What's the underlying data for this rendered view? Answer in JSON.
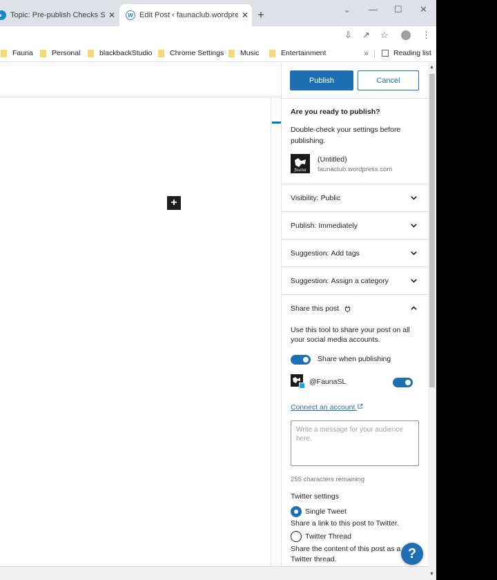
{
  "browser": {
    "tabs": [
      {
        "title": "Topic: Pre-publish Checks Sideba",
        "close": "✕"
      },
      {
        "title": "Edit Post ‹ faunaclub.wordpress.c",
        "close": "✕"
      }
    ],
    "new_tab": "+",
    "bookmarks": [
      "Fauna",
      "Personal",
      "blackbackStudio",
      "Chrome Settings",
      "Music",
      "Entertainment"
    ],
    "bookmarks_more": "»",
    "reading_list": "Reading list"
  },
  "prepublish": {
    "publish_label": "Publish",
    "cancel_label": "Cancel",
    "ready_title": "Are you ready to publish?",
    "ready_desc": "Double-check your settings before publishing.",
    "post_title": "(Untitled)",
    "site_url": "faunaclub.wordpress.com",
    "rows": [
      {
        "key": "Visibility:",
        "value": "Public"
      },
      {
        "key": "Publish:",
        "value": "Immediately"
      },
      {
        "key": "Suggestion:",
        "value": "Add tags"
      },
      {
        "key": "Suggestion:",
        "value": "Assign a category"
      }
    ],
    "share": {
      "title": "Share this post",
      "description": "Use this tool to share your post on all your social media accounts.",
      "toggle_label": "Share when publishing",
      "share_when_publishing": true,
      "account": "@FaunaSL",
      "account_enabled": true,
      "connect_link": "Connect an account",
      "message_placeholder": "Write a message for your audience here.",
      "remaining": "255 characters remaining",
      "twitter_settings": "Twitter settings",
      "options": [
        {
          "label": "Single Tweet",
          "desc": "Share a link to this post to Twitter.",
          "selected": true
        },
        {
          "label": "Twitter Thread",
          "desc": "Share the content of this post as a Twitter thread.",
          "selected": false
        }
      ]
    }
  },
  "help_label": "?",
  "colors": {
    "accent": "#1e6fb3",
    "link": "#1e6fb3"
  }
}
